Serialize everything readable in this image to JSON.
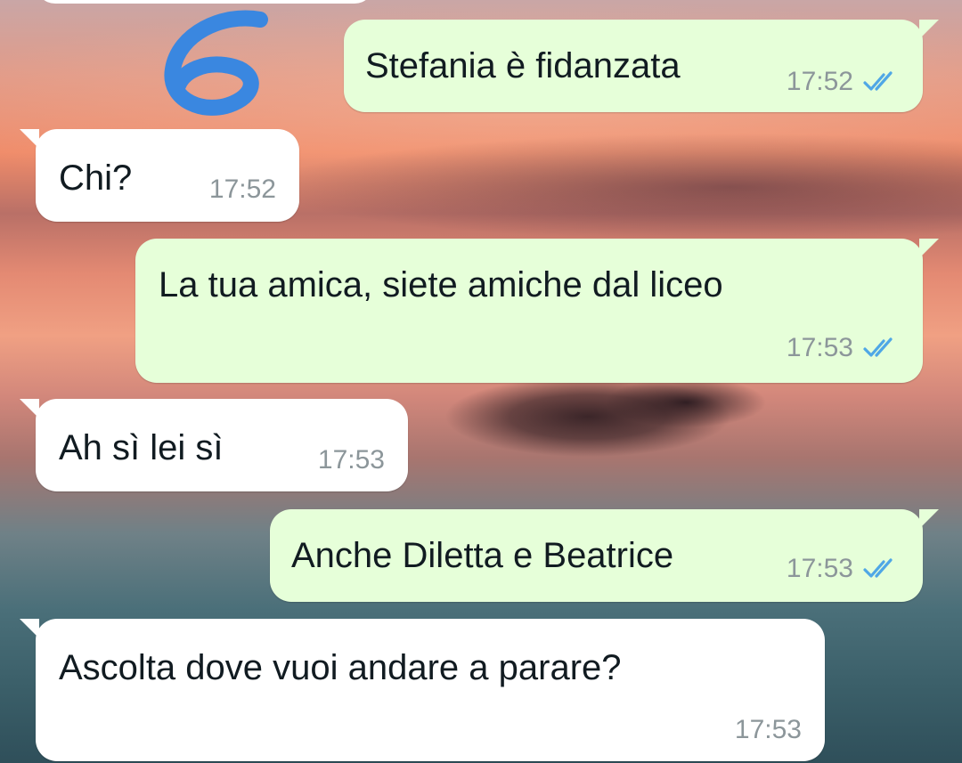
{
  "conversation": {
    "messages": [
      {
        "direction": "outgoing",
        "text": "Stefania è fidanzata",
        "time": "17:52",
        "status": "read"
      },
      {
        "direction": "incoming",
        "text": "Chi?",
        "time": "17:52"
      },
      {
        "direction": "outgoing",
        "text": "La tua amica, siete amiche dal liceo",
        "time": "17:53",
        "status": "read"
      },
      {
        "direction": "incoming",
        "text": "Ah sì lei sì",
        "time": "17:53"
      },
      {
        "direction": "outgoing",
        "text": "Anche Diletta e Beatrice",
        "time": "17:53",
        "status": "read"
      },
      {
        "direction": "incoming",
        "text": "Ascolta dove vuoi andare a parare?",
        "time": "17:53"
      }
    ]
  },
  "annotation": {
    "text": "6",
    "color": "#3a87e0"
  },
  "colors": {
    "outgoing_bubble": "#e6ffd9",
    "incoming_bubble": "#ffffff",
    "read_ticks": "#4fa7e6",
    "timestamp": "#8c969a"
  },
  "icons": {
    "read_receipt": "double-check-icon"
  }
}
